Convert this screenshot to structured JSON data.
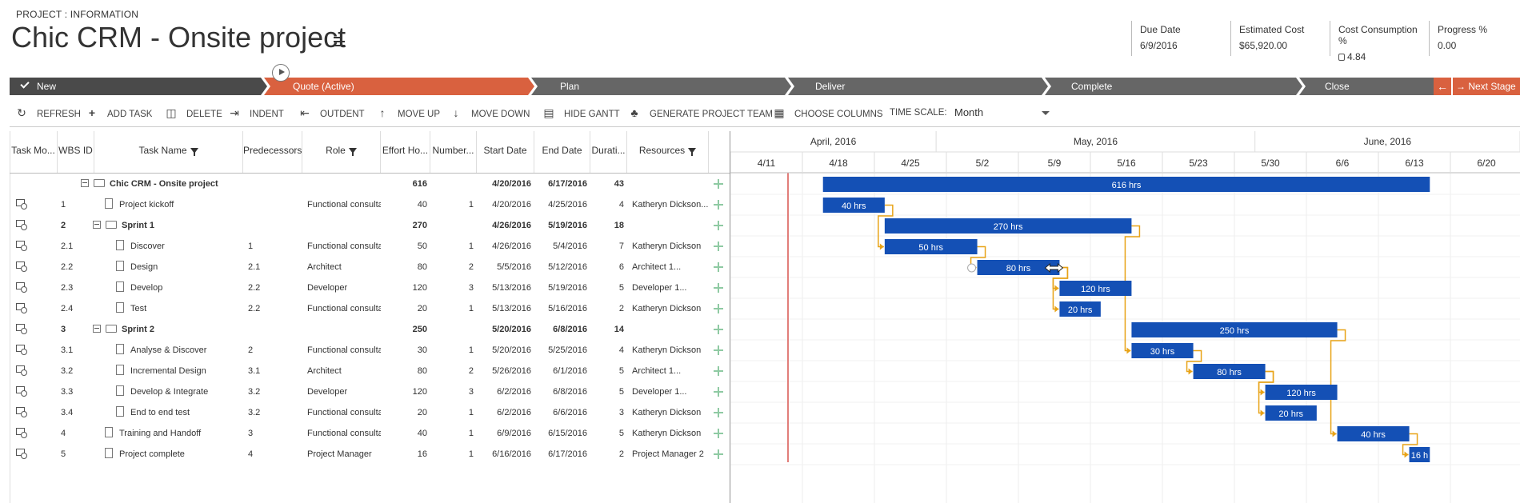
{
  "header": {
    "breadcrumb": "PROJECT : INFORMATION",
    "title": "Chic CRM - Onsite project",
    "kpis": [
      {
        "label": "Due Date",
        "value": "6/9/2016"
      },
      {
        "label": "Estimated Cost",
        "value": "$65,920.00"
      },
      {
        "label": "Cost Consumption %",
        "value": "4.84"
      },
      {
        "label": "Progress %",
        "value": "0.00"
      }
    ]
  },
  "stages": [
    {
      "label": "New",
      "state": "completed"
    },
    {
      "label": "Quote (Active)",
      "state": "active"
    },
    {
      "label": "Plan",
      "state": "inactive"
    },
    {
      "label": "Deliver",
      "state": "inactive"
    },
    {
      "label": "Complete",
      "state": "inactive"
    },
    {
      "label": "Close",
      "state": "inactive"
    }
  ],
  "next_stage_label": "Next Stage",
  "toolbar": {
    "refresh": "REFRESH",
    "add_task": "ADD TASK",
    "delete": "DELETE",
    "indent": "INDENT",
    "outdent": "OUTDENT",
    "move_up": "MOVE UP",
    "move_down": "MOVE DOWN",
    "hide_gantt": "HIDE GANTT",
    "generate_team": "GENERATE PROJECT TEAM",
    "choose_columns": "CHOOSE COLUMNS",
    "time_scale_label": "TIME SCALE:",
    "time_scale_value": "Month"
  },
  "columns": [
    "Task Mo...",
    "WBS ID",
    "Task Name",
    "Predecessors",
    "Role",
    "Effort Ho...",
    "Number...",
    "Start Date",
    "End Date",
    "Durati...",
    "Resources"
  ],
  "tasks": [
    {
      "wbs": "",
      "name": "Chic CRM - Onsite project",
      "pred": "",
      "role": "",
      "effort": "616",
      "number": "",
      "start": "4/20/2016",
      "end": "6/17/2016",
      "duration": "43",
      "resources": "",
      "bold": true,
      "level": 0,
      "summary": true,
      "icon": false,
      "bar_label": "616 hrs"
    },
    {
      "wbs": "1",
      "name": "Project kickoff",
      "pred": "",
      "role": "Functional consultar",
      "effort": "40",
      "number": "1",
      "start": "4/20/2016",
      "end": "4/25/2016",
      "duration": "4",
      "resources": "Katheryn Dickson...",
      "bold": false,
      "level": 1,
      "summary": false,
      "icon": true,
      "bar_label": "40 hrs"
    },
    {
      "wbs": "2",
      "name": "Sprint 1",
      "pred": "",
      "role": "",
      "effort": "270",
      "number": "",
      "start": "4/26/2016",
      "end": "5/19/2016",
      "duration": "18",
      "resources": "",
      "bold": true,
      "level": 1,
      "summary": true,
      "icon": true,
      "bar_label": "270 hrs"
    },
    {
      "wbs": "2.1",
      "name": "Discover",
      "pred": "1",
      "role": "Functional consultar",
      "effort": "50",
      "number": "1",
      "start": "4/26/2016",
      "end": "5/4/2016",
      "duration": "7",
      "resources": "Katheryn Dickson",
      "bold": false,
      "level": 2,
      "summary": false,
      "icon": true,
      "bar_label": "50 hrs"
    },
    {
      "wbs": "2.2",
      "name": "Design",
      "pred": "2.1",
      "role": "Architect",
      "effort": "80",
      "number": "2",
      "start": "5/5/2016",
      "end": "5/12/2016",
      "duration": "6",
      "resources": "Architect 1...",
      "bold": false,
      "level": 2,
      "summary": false,
      "icon": true,
      "bar_label": "80 hrs"
    },
    {
      "wbs": "2.3",
      "name": "Develop",
      "pred": "2.2",
      "role": "Developer",
      "effort": "120",
      "number": "3",
      "start": "5/13/2016",
      "end": "5/19/2016",
      "duration": "5",
      "resources": "Developer 1...",
      "bold": false,
      "level": 2,
      "summary": false,
      "icon": true,
      "bar_label": "120 hrs"
    },
    {
      "wbs": "2.4",
      "name": "Test",
      "pred": "2.2",
      "role": "Functional consultar",
      "effort": "20",
      "number": "1",
      "start": "5/13/2016",
      "end": "5/16/2016",
      "duration": "2",
      "resources": "Katheryn Dickson",
      "bold": false,
      "level": 2,
      "summary": false,
      "icon": true,
      "bar_label": "20 hrs"
    },
    {
      "wbs": "3",
      "name": "Sprint 2",
      "pred": "",
      "role": "",
      "effort": "250",
      "number": "",
      "start": "5/20/2016",
      "end": "6/8/2016",
      "duration": "14",
      "resources": "",
      "bold": true,
      "level": 1,
      "summary": true,
      "icon": true,
      "bar_label": "250 hrs"
    },
    {
      "wbs": "3.1",
      "name": "Analyse & Discover",
      "pred": "2",
      "role": "Functional consultar",
      "effort": "30",
      "number": "1",
      "start": "5/20/2016",
      "end": "5/25/2016",
      "duration": "4",
      "resources": "Katheryn Dickson",
      "bold": false,
      "level": 2,
      "summary": false,
      "icon": true,
      "bar_label": "30 hrs"
    },
    {
      "wbs": "3.2",
      "name": "Incremental Design",
      "pred": "3.1",
      "role": "Architect",
      "effort": "80",
      "number": "2",
      "start": "5/26/2016",
      "end": "6/1/2016",
      "duration": "5",
      "resources": "Architect 1...",
      "bold": false,
      "level": 2,
      "summary": false,
      "icon": true,
      "bar_label": "80 hrs"
    },
    {
      "wbs": "3.3",
      "name": "Develop & Integrate",
      "pred": "3.2",
      "role": "Developer",
      "effort": "120",
      "number": "3",
      "start": "6/2/2016",
      "end": "6/8/2016",
      "duration": "5",
      "resources": "Developer 1...",
      "bold": false,
      "level": 2,
      "summary": false,
      "icon": true,
      "bar_label": "120 hrs"
    },
    {
      "wbs": "3.4",
      "name": "End to end test",
      "pred": "3.2",
      "role": "Functional consultar",
      "effort": "20",
      "number": "1",
      "start": "6/2/2016",
      "end": "6/6/2016",
      "duration": "3",
      "resources": "Katheryn Dickson",
      "bold": false,
      "level": 2,
      "summary": false,
      "icon": true,
      "bar_label": "20 hrs"
    },
    {
      "wbs": "4",
      "name": "Training and Handoff",
      "pred": "3",
      "role": "Functional consultar",
      "effort": "40",
      "number": "1",
      "start": "6/9/2016",
      "end": "6/15/2016",
      "duration": "5",
      "resources": "Katheryn Dickson",
      "bold": false,
      "level": 1,
      "summary": false,
      "icon": true,
      "bar_label": "40 hrs"
    },
    {
      "wbs": "5",
      "name": "Project complete",
      "pred": "4",
      "role": "Project Manager",
      "effort": "16",
      "number": "1",
      "start": "6/16/2016",
      "end": "6/17/2016",
      "duration": "2",
      "resources": "Project Manager 2",
      "bold": false,
      "level": 1,
      "summary": false,
      "icon": true,
      "bar_label": "16 h"
    }
  ],
  "timeline": {
    "months": [
      "April, 2016",
      "May, 2016",
      "June, 2016"
    ],
    "weeks": [
      "4/11",
      "4/18",
      "4/25",
      "5/2",
      "5/9",
      "5/16",
      "5/23",
      "5/30",
      "6/6",
      "6/13",
      "6/20"
    ]
  },
  "colors": {
    "bar": "#1450b5",
    "connector": "#e8a317",
    "stage_active": "#d9613f",
    "today_line": "#d9534f"
  },
  "icons": {
    "refresh": "refresh-icon",
    "add": "plus-icon",
    "delete": "trash-icon",
    "indent": "indent-icon",
    "outdent": "outdent-icon",
    "move_up": "arrow-up-icon",
    "move_down": "arrow-down-icon",
    "hide_gantt": "chart-icon",
    "team": "team-icon",
    "columns": "columns-icon"
  }
}
